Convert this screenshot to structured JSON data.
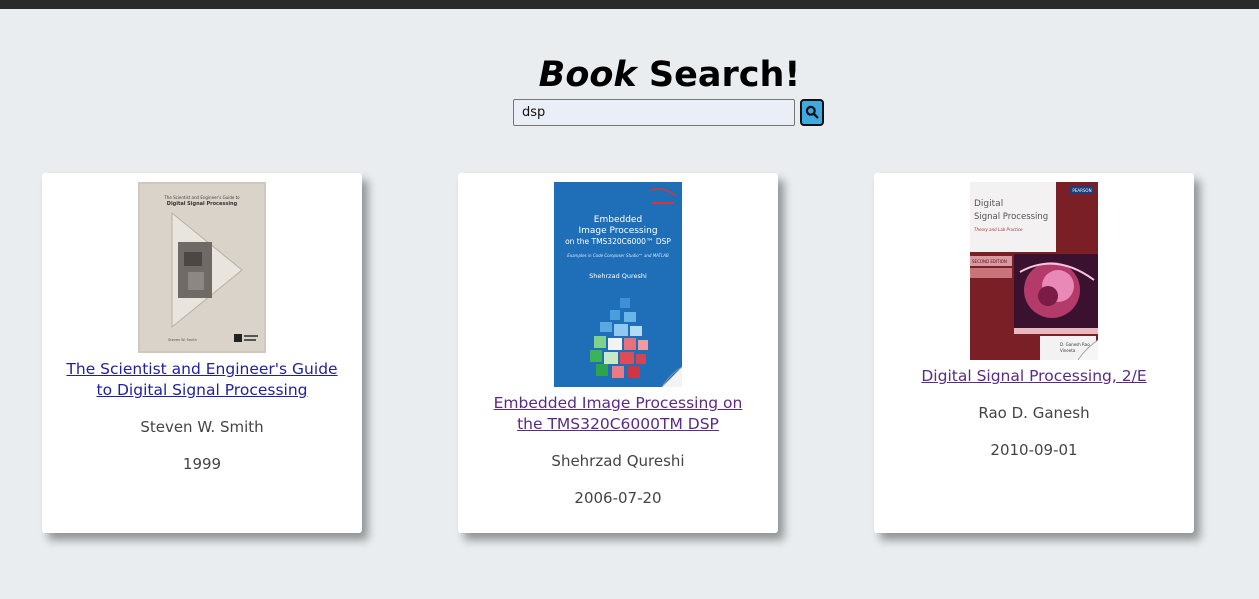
{
  "header": {
    "title_italic": "Book",
    "title_rest": " Search!"
  },
  "search": {
    "value": "dsp",
    "button_icon": "search-icon"
  },
  "results": [
    {
      "title": "The Scientist and Engineer's Guide to Digital Signal Processing",
      "author": "Steven W. Smith",
      "date": "1999",
      "cover_text": [
        "The Scientist and Engineer's Guide to",
        "Digital Signal Processing",
        "Steven W. Smith"
      ]
    },
    {
      "title": "Embedded Image Processing on the TMS320C6000TM DSP",
      "author": "Shehrzad Qureshi",
      "date": "2006-07-20",
      "cover_text": [
        "Embedded",
        "Image Processing",
        "on the TMS320C6000™ DSP",
        "Examples in Code Composer Studio™ and MATLAB",
        "Shehrzad Qureshi"
      ]
    },
    {
      "title": "Digital Signal Processing, 2/E",
      "author": "Rao D. Ganesh",
      "date": "2010-09-01",
      "cover_text": [
        "Digital",
        "Signal Processing",
        "Theory and Lab Practice",
        "SECOND EDITION",
        "PEARSON",
        "D. Ganesh Rao",
        "Vineeta"
      ]
    }
  ],
  "colors": {
    "background": "#e9edf0",
    "link": "#1f1fa5",
    "link_visited": "#5a2a86",
    "search_button": "#40a9e0"
  }
}
